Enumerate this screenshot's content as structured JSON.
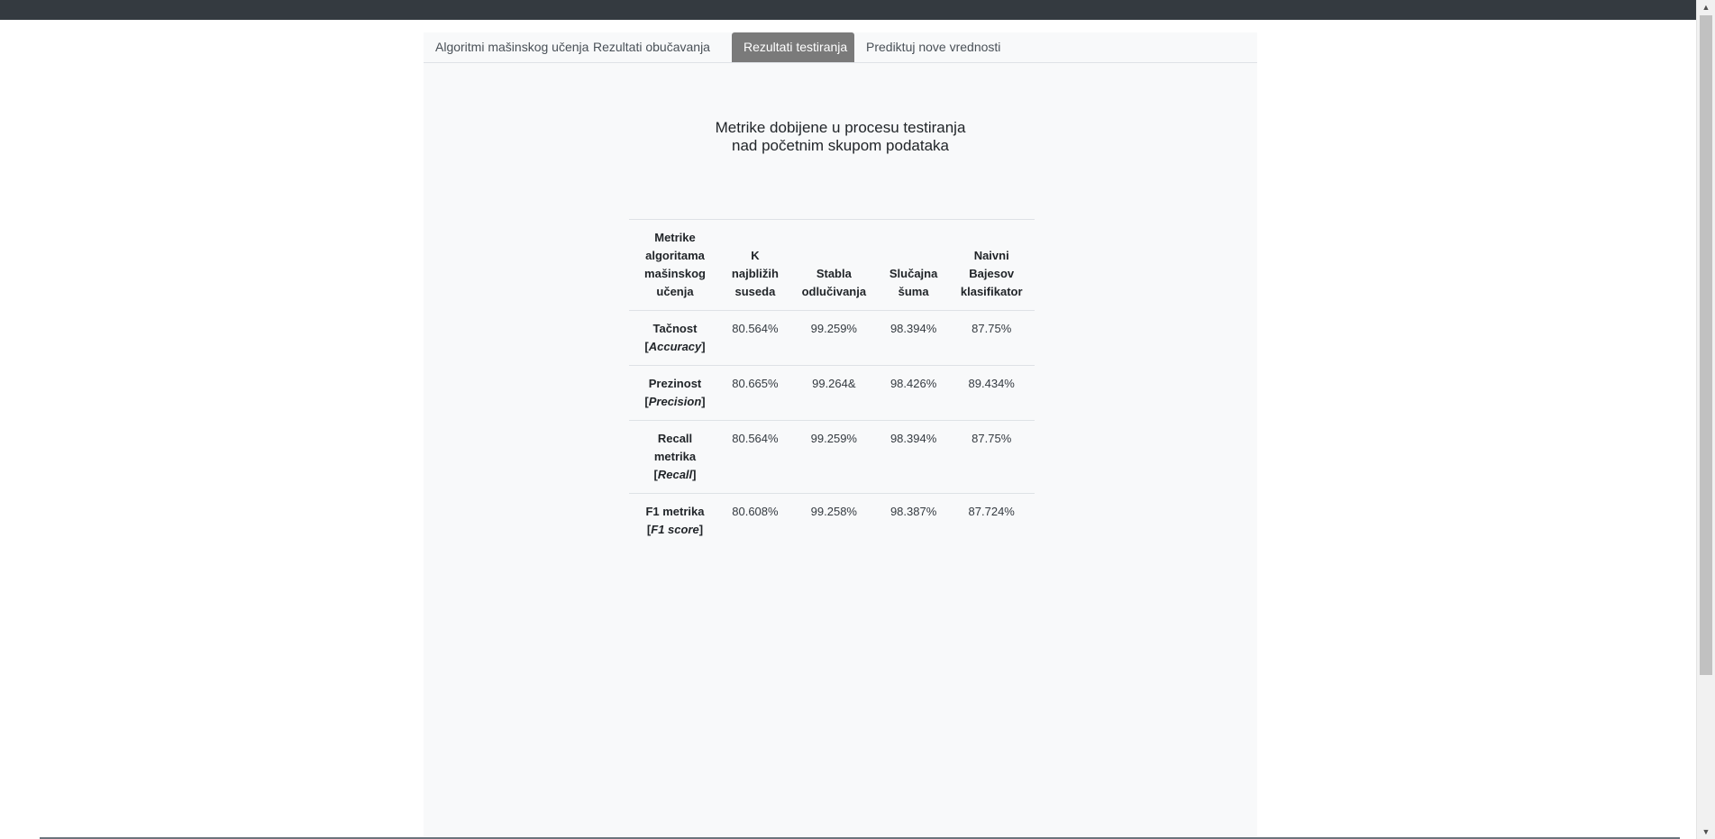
{
  "tabs": [
    {
      "label": "Algoritmi mašinskog učenja",
      "active": false
    },
    {
      "label": "Rezultati obučavanja",
      "active": false
    },
    {
      "label": "Rezultati testiranja",
      "active": true
    },
    {
      "label": "Prediktuj nove vrednosti",
      "active": false
    }
  ],
  "heading": {
    "line1": "Metrike dobijene u procesu testiranja",
    "line2": "nad početnim skupom podataka"
  },
  "table": {
    "headers": {
      "metric": [
        "Metrike",
        "algoritama",
        "mašinskog",
        "učenja"
      ],
      "knn": [
        "K",
        "najbližih",
        "suseda"
      ],
      "dt": [
        "Stabla",
        "odlučivanja"
      ],
      "rf": [
        "Slučajna",
        "šuma"
      ],
      "nb": [
        "Naivni",
        "Bajesov",
        "klasifikator"
      ]
    },
    "rows": [
      {
        "name": "Tačnost",
        "name_lines": [],
        "term": "Accuracy",
        "values": [
          "80.564%",
          "99.259%",
          "98.394%",
          "87.75%"
        ]
      },
      {
        "name": "Prezinost",
        "name_lines": [],
        "term": "Precision",
        "values": [
          "80.665%",
          "99.264&",
          "98.426%",
          "89.434%"
        ]
      },
      {
        "name": "Recall",
        "name_lines": [
          "metrika"
        ],
        "term": "Recall",
        "values": [
          "80.564%",
          "99.259%",
          "98.394%",
          "87.75%"
        ]
      },
      {
        "name": "F1 metrika",
        "name_lines": [],
        "term": "F1 score",
        "values": [
          "80.608%",
          "99.258%",
          "98.387%",
          "87.724%"
        ]
      }
    ]
  },
  "scrollbar": {
    "up_icon": "triangle-up",
    "down_icon": "triangle-down"
  }
}
